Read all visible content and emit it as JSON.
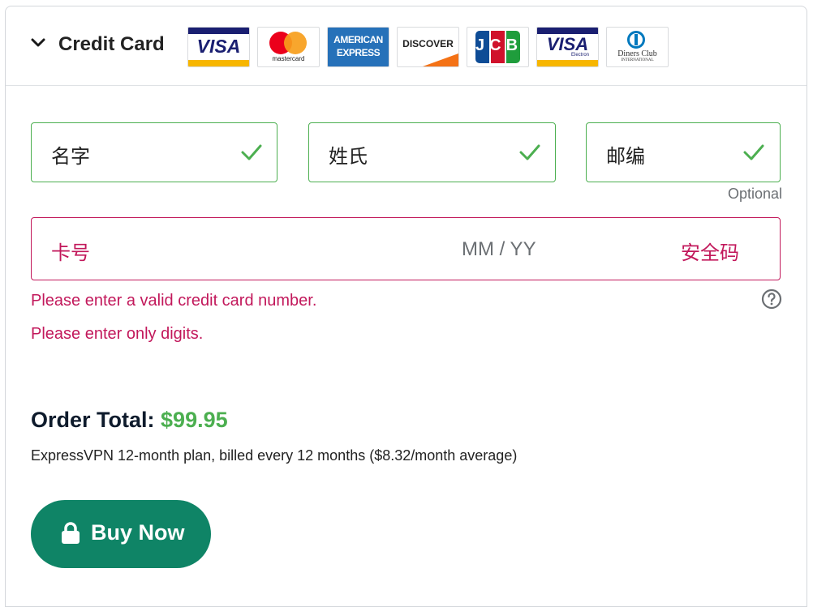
{
  "header": {
    "title": "Credit Card",
    "chevron_icon": "chevron-down-icon",
    "cards": [
      {
        "name": "visa",
        "text": "VISA"
      },
      {
        "name": "mastercard",
        "text": "mastercard"
      },
      {
        "name": "amex",
        "text1": "AMERICAN",
        "text2": "EXPRESS"
      },
      {
        "name": "discover",
        "text": "DISCOVER"
      },
      {
        "name": "jcb",
        "text": "JCB"
      },
      {
        "name": "visa-electron",
        "text": "VISA",
        "sub": "Electron"
      },
      {
        "name": "diners",
        "text1": "Diners Club",
        "text2": "INTERNATIONAL"
      }
    ]
  },
  "form": {
    "first_name_placeholder": "名字",
    "last_name_placeholder": "姓氏",
    "zip_placeholder": "邮编",
    "zip_note": "Optional",
    "card_number_placeholder": "卡号",
    "expiry_placeholder": "MM /  YY",
    "cvc_placeholder": "安全码",
    "errors": [
      "Please enter a valid credit card number.",
      "Please enter only digits."
    ]
  },
  "order": {
    "total_label": "Order Total:",
    "total_amount": "$99.95",
    "plan_text": "ExpressVPN 12-month plan, billed every 12 months ($8.32/month average)"
  },
  "buy_button": {
    "label": "Buy Now",
    "icon": "lock-icon"
  },
  "colors": {
    "valid": "#4caf50",
    "error": "#c2185b",
    "button": "#0f8466"
  }
}
